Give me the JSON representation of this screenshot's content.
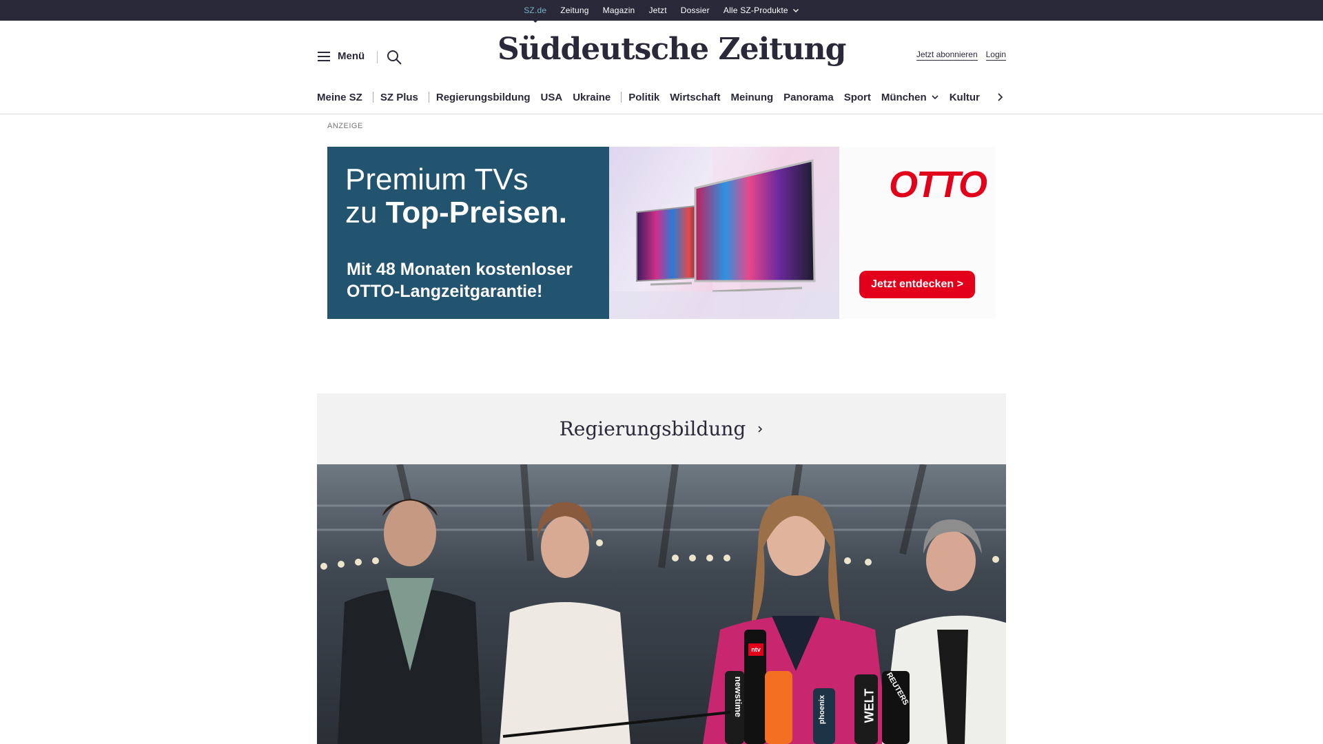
{
  "topbar": {
    "items": [
      {
        "label": "SZ.de"
      },
      {
        "label": "Zeitung"
      },
      {
        "label": "Magazin"
      },
      {
        "label": "Jetzt"
      },
      {
        "label": "Dossier"
      },
      {
        "label": "Alle SZ-Produkte"
      }
    ],
    "active_color": "#74b4c6",
    "background": "#29293a"
  },
  "header": {
    "menu_label": "Menü",
    "logo_text": "Süddeutsche Zeitung",
    "subscribe_label": "Jetzt abonnieren",
    "login_label": "Login"
  },
  "nav": {
    "items": [
      {
        "label": "Meine SZ"
      },
      {
        "label": "SZ Plus"
      },
      {
        "label": "Regierungsbildung"
      },
      {
        "label": "USA"
      },
      {
        "label": "Ukraine"
      },
      {
        "label": "Politik"
      },
      {
        "label": "Wirtschaft"
      },
      {
        "label": "Meinung"
      },
      {
        "label": "Panorama"
      },
      {
        "label": "Sport"
      },
      {
        "label": "München"
      },
      {
        "label": "Kultur"
      }
    ]
  },
  "ad": {
    "label": "ANZEIGE",
    "headline_line1": "Premium TVs",
    "headline_line2_prefix": "zu ",
    "headline_line2_bold": "Top-Preisen.",
    "sub_line1": "Mit 48 Monaten kostenloser",
    "sub_line2": "OTTO-Langzeitgarantie!",
    "brand": "OTTO",
    "cta": "Jetzt entdecken >",
    "brand_color": "#e3001b",
    "panel_color": "#22546f"
  },
  "topic": {
    "title": "Regierungsbildung"
  },
  "hero": {
    "microphone_labels": [
      "newstime",
      "phoenix",
      "WELT",
      "REUTERS",
      "ntv"
    ]
  }
}
